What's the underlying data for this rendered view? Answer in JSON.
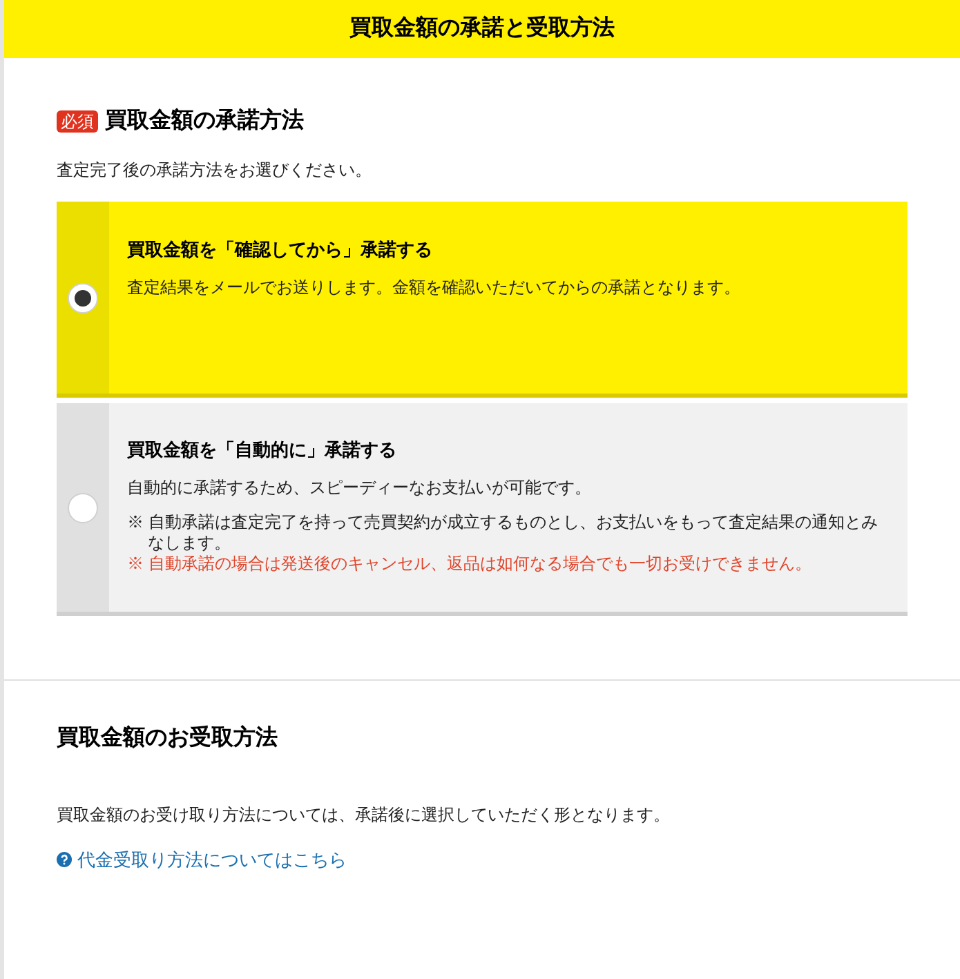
{
  "header": {
    "title": "買取金額の承諾と受取方法"
  },
  "acceptance": {
    "badge": "必須",
    "title": "買取金額の承諾方法",
    "description": "査定完了後の承諾方法をお選びください。",
    "options": [
      {
        "title": "買取金額を「確認してから」承諾する",
        "description": "査定結果をメールでお送りします。金額を確認いただいてからの承諾となります。",
        "selected": true
      },
      {
        "title": "買取金額を「自動的に」承諾する",
        "description": "自動的に承諾するため、スピーディーなお支払いが可能です。",
        "selected": false,
        "notes": [
          {
            "kind": "info",
            "mark": "※",
            "text": "自動承諾は査定完了を持って売買契約が成立するものとし、お支払いをもって査定結果の通知とみなします。"
          },
          {
            "kind": "warning",
            "mark": "※",
            "text": "自動承諾の場合は発送後のキャンセル、返品は如何なる場合でも一切お受けできません。"
          }
        ]
      }
    ]
  },
  "receipt": {
    "title": "買取金額のお受取方法",
    "description": "買取金額のお受け取り方法については、承諾後に選択していただく形となります。",
    "link": "代金受取り方法についてはこちら"
  }
}
